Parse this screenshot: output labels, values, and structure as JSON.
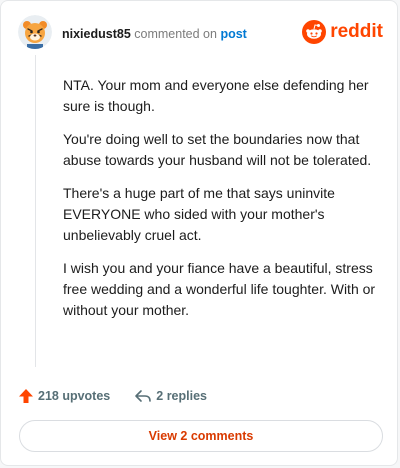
{
  "header": {
    "username": "nixiedust85",
    "commented_on": "commented on",
    "post_link": "post",
    "brand": "reddit"
  },
  "comment": {
    "paragraphs": [
      "NTA. Your mom and everyone else defending her sure is though.",
      "You're doing well to set the boundaries now that abuse towards your husband will not be tolerated.",
      "There's a huge part of me that says uninvite EVERYONE who sided with your mother's unbelievably cruel act.",
      "I wish you and your fiance have a beautiful, stress free wedding and a wonderful life toughter. With or without your mother."
    ]
  },
  "actions": {
    "upvotes": "218 upvotes",
    "replies": "2 replies"
  },
  "view_comments": "View 2 comments",
  "colors": {
    "accent": "#ff4500",
    "link": "#0079d3",
    "button_text": "#d93a00"
  }
}
